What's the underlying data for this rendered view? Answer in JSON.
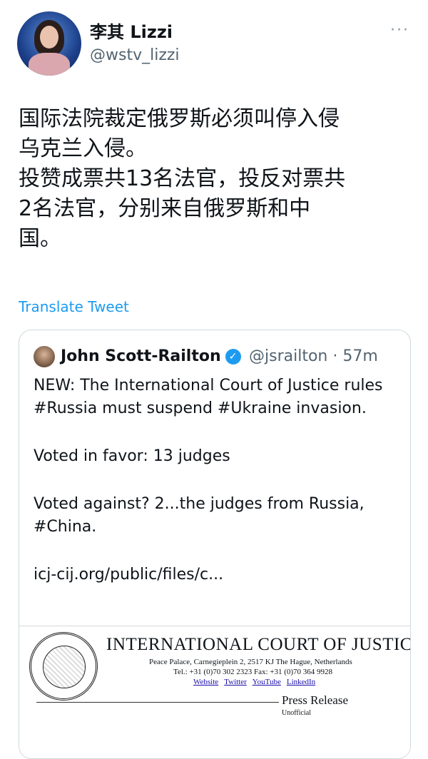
{
  "author": {
    "name": "李其 Lizzi",
    "handle": "@wstv_lizzi"
  },
  "more_icon": "···",
  "tweet_lines": [
    "国际法院裁定俄罗斯必须叫停入侵",
    "乌克兰入侵。",
    "投赞成票共13名法官，投反对票共",
    "2名法官，分别来自俄罗斯和中",
    "国。"
  ],
  "translate_label": "Translate Tweet",
  "quote": {
    "name": "John Scott-Railton",
    "verified_icon": "✓",
    "meta": "@jsrailton · 57m",
    "paragraphs": [
      "NEW: The International Court of Justice rules #Russia must suspend #Ukraine invasion.",
      "Voted in favor: 13 judges",
      "Voted against? 2...the judges from Russia, #China.",
      "icj-cij.org/public/files/c..."
    ],
    "document": {
      "title": "INTERNATIONAL COURT OF JUSTICE",
      "address": "Peace Palace, Carnegieplein 2, 2517 KJ  The Hague, Netherlands",
      "tel": "Tel.: +31 (0)70 302 2323   Fax: +31 (0)70 364 9928",
      "links": [
        "Website",
        "Twitter",
        "YouTube",
        "LinkedIn"
      ],
      "press_release": "Press Release",
      "unofficial": "Unofficial"
    }
  },
  "colors": {
    "accent": "#1d9bf0",
    "secondary_text": "#536471",
    "border": "#cfd9de"
  }
}
